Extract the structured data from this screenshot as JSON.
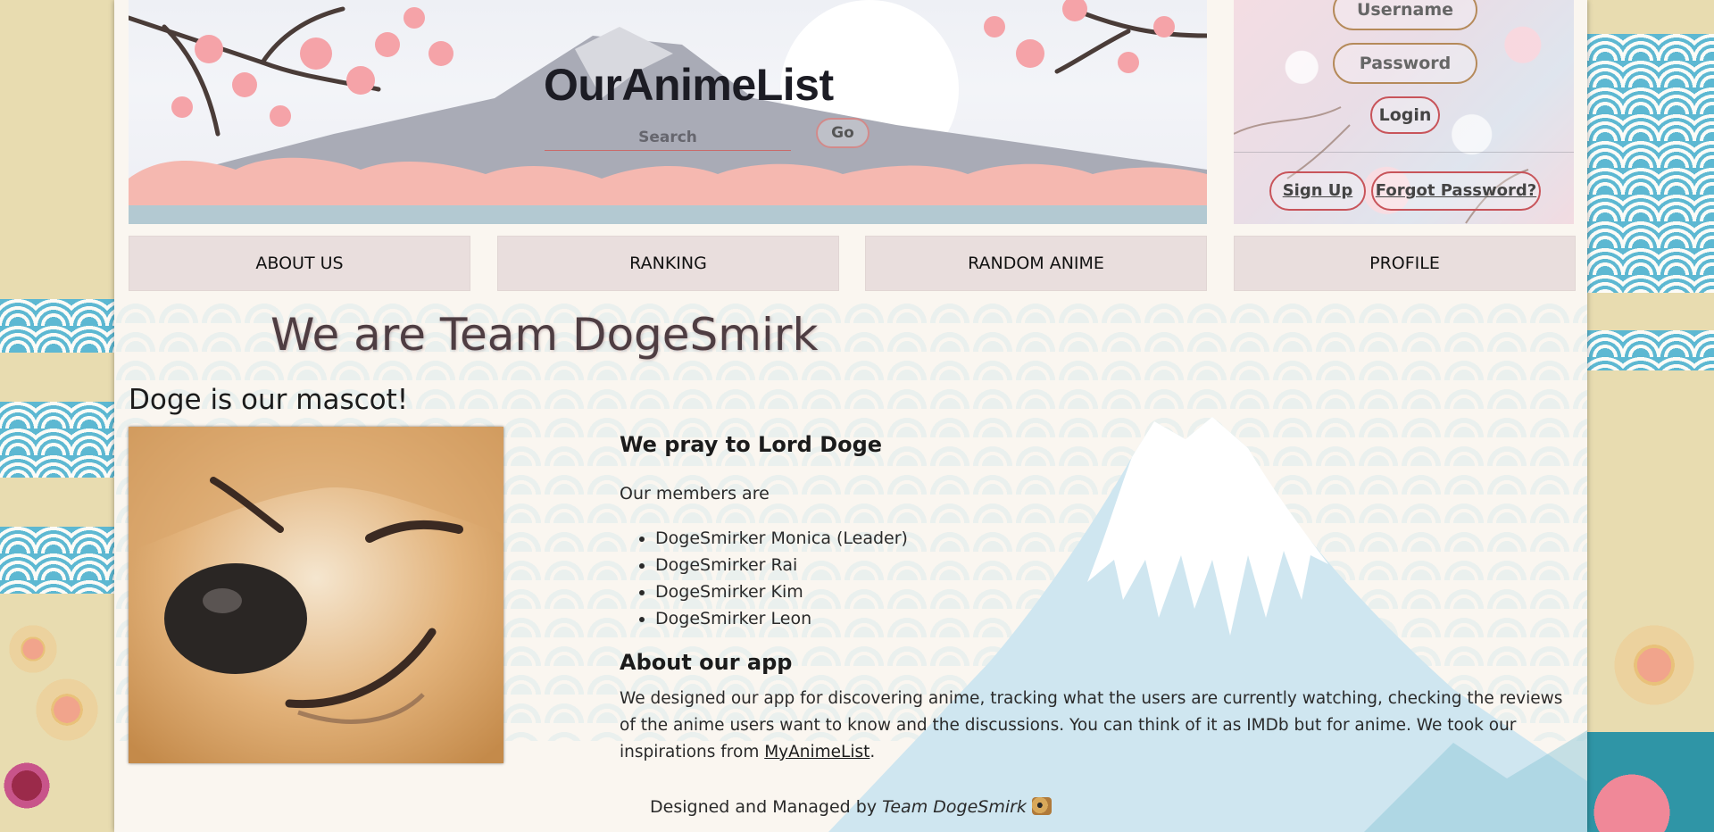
{
  "header": {
    "site_title": "OurAnimeList",
    "search_placeholder": "Search",
    "go_label": "Go"
  },
  "login": {
    "username_placeholder": "Username",
    "password_placeholder": "Password",
    "login_label": "Login",
    "signup_label": "Sign Up",
    "forgot_label": "Forgot Password?"
  },
  "nav": {
    "items": [
      {
        "label": "ABOUT US"
      },
      {
        "label": "RANKING"
      },
      {
        "label": "RANDOM ANIME"
      },
      {
        "label": "PROFILE"
      }
    ]
  },
  "content": {
    "team_heading": "We are Team DogeSmirk",
    "mascot_heading": "Doge is our mascot!",
    "pray_heading": "We pray to Lord Doge",
    "members_intro": "Our members are",
    "members": [
      "DogeSmirker Monica (Leader)",
      "DogeSmirker Rai",
      "DogeSmirker Kim",
      "DogeSmirker Leon"
    ],
    "about_heading": "About our app",
    "about_text": "We designed our app for discovering anime, tracking what the users are currently watching, checking the reviews of the anime users want to know and the discussions. You can think of it as IMDb but for anime. We took our inspirations from ",
    "about_link": "MyAnimeList",
    "about_end": "."
  },
  "footer": {
    "prefix": "Designed and Managed by ",
    "team": "Team DogeSmirk"
  },
  "colors": {
    "nav_bg": "#e9dedd",
    "accent_red": "#c8545a",
    "page_bg": "#faf6f0",
    "side_bg": "#e8dcb0"
  }
}
